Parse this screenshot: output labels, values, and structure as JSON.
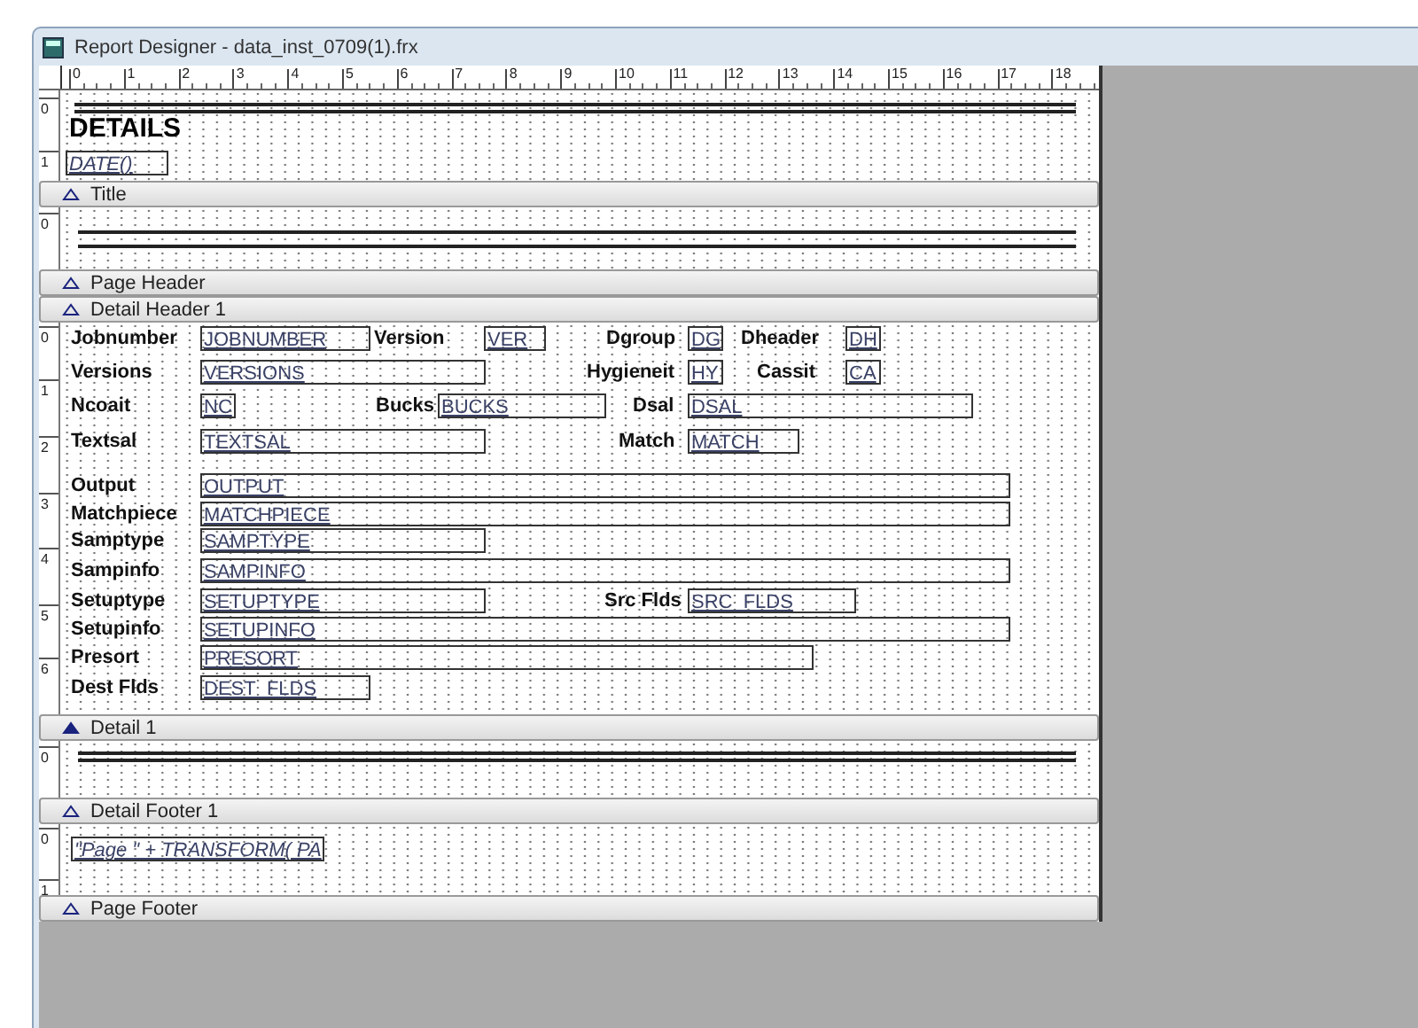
{
  "window": {
    "title": "Report Designer - data_inst_0709(1).frx"
  },
  "ruler": {
    "marks": [
      "0",
      "1",
      "2",
      "3",
      "4",
      "5",
      "6",
      "7",
      "8",
      "9",
      "10",
      "11",
      "12",
      "13",
      "14",
      "15",
      "16",
      "17",
      "18"
    ]
  },
  "bands": [
    {
      "label": "Title",
      "selected": false,
      "ruler_marks": [
        "0",
        "1"
      ],
      "items": [
        {
          "kind": "line"
        },
        {
          "kind": "line"
        },
        {
          "kind": "heading",
          "text": "DETAILS"
        },
        {
          "kind": "expression",
          "text": "DATE()"
        }
      ]
    },
    {
      "label": "Page Header",
      "selected": false,
      "ruler_marks": [
        "0"
      ],
      "items": [
        {
          "kind": "line"
        },
        {
          "kind": "line"
        }
      ]
    },
    {
      "label": "Detail Header 1",
      "selected": false
    },
    {
      "label": "Detail 1",
      "selected": true,
      "ruler_marks": [
        "0",
        "1",
        "2",
        "3",
        "4",
        "5",
        "6"
      ],
      "items": [
        {
          "kind": "label",
          "text": "Jobnumber"
        },
        {
          "kind": "field",
          "text": "JOBNUMBER"
        },
        {
          "kind": "label",
          "text": "Version"
        },
        {
          "kind": "field",
          "text": "VER"
        },
        {
          "kind": "label",
          "text": "Dgroup"
        },
        {
          "kind": "field",
          "text": "DG"
        },
        {
          "kind": "label",
          "text": "Dheader"
        },
        {
          "kind": "field",
          "text": "DH"
        },
        {
          "kind": "label",
          "text": "Versions"
        },
        {
          "kind": "field",
          "text": "VERSIONS"
        },
        {
          "kind": "label",
          "text": "Hygieneit"
        },
        {
          "kind": "field",
          "text": "HY"
        },
        {
          "kind": "label",
          "text": "Cassit"
        },
        {
          "kind": "field",
          "text": "CA"
        },
        {
          "kind": "label",
          "text": "Ncoait"
        },
        {
          "kind": "field",
          "text": "NC"
        },
        {
          "kind": "label",
          "text": "Bucks"
        },
        {
          "kind": "field",
          "text": "BUCKS"
        },
        {
          "kind": "label",
          "text": "Dsal"
        },
        {
          "kind": "field",
          "text": "DSAL"
        },
        {
          "kind": "label",
          "text": "Textsal"
        },
        {
          "kind": "field",
          "text": "TEXTSAL"
        },
        {
          "kind": "label",
          "text": "Match"
        },
        {
          "kind": "field",
          "text": "MATCH"
        },
        {
          "kind": "label",
          "text": "Output"
        },
        {
          "kind": "field",
          "text": "OUTPUT"
        },
        {
          "kind": "label",
          "text": "Matchpiece"
        },
        {
          "kind": "field",
          "text": "MATCHPIECE"
        },
        {
          "kind": "label",
          "text": "Samptype"
        },
        {
          "kind": "field",
          "text": "SAMPTYPE"
        },
        {
          "kind": "label",
          "text": "Sampinfo"
        },
        {
          "kind": "field",
          "text": "SAMPINFO"
        },
        {
          "kind": "label",
          "text": "Setuptype"
        },
        {
          "kind": "field",
          "text": "SETUPTYPE"
        },
        {
          "kind": "label",
          "text": "Src Flds"
        },
        {
          "kind": "field",
          "text": "SRC_FLDS"
        },
        {
          "kind": "label",
          "text": "Setupinfo"
        },
        {
          "kind": "field",
          "text": "SETUPINFO"
        },
        {
          "kind": "label",
          "text": "Presort"
        },
        {
          "kind": "field",
          "text": "PRESORT"
        },
        {
          "kind": "label",
          "text": "Dest Flds"
        },
        {
          "kind": "field",
          "text": "DEST_FLDS"
        }
      ]
    },
    {
      "label": "Detail Footer 1",
      "selected": false,
      "ruler_marks": [
        "0"
      ],
      "items": [
        {
          "kind": "line"
        },
        {
          "kind": "line"
        }
      ]
    },
    {
      "label": "Page Footer",
      "selected": false,
      "ruler_marks": [
        "0",
        "1"
      ],
      "items": [
        {
          "kind": "expression",
          "text": "\"Page \" + TRANSFORM( PA"
        }
      ]
    }
  ]
}
